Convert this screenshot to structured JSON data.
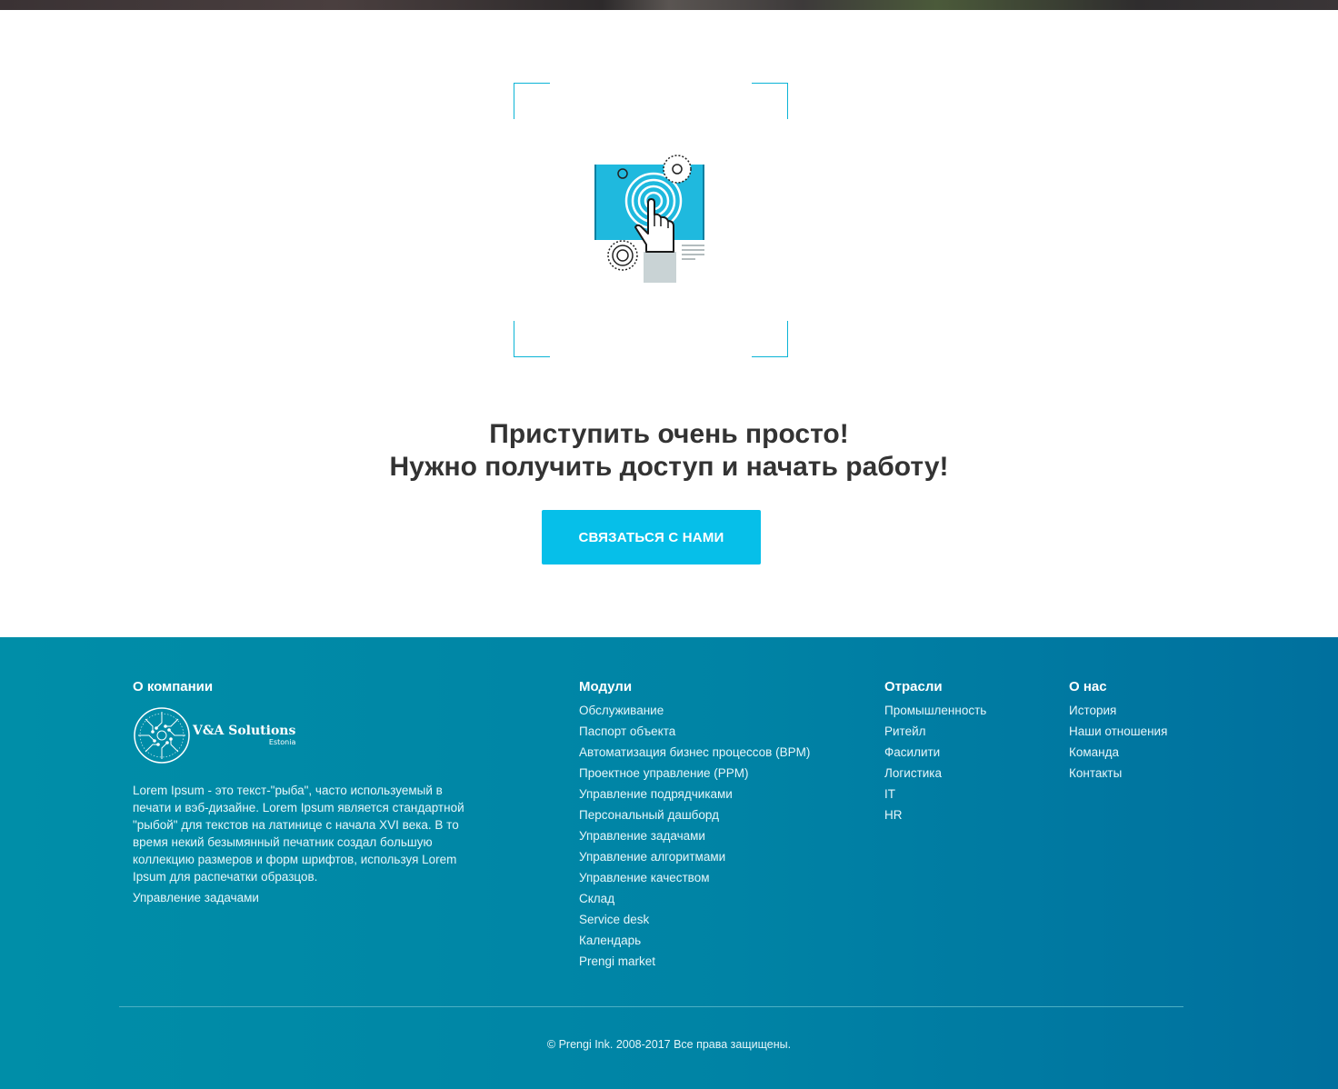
{
  "headline": {
    "line1": "Приступить очень просто!",
    "line2": "Нужно получить доступ и начать работу!"
  },
  "cta": {
    "label": "СВЯЗАТЬСЯ С НАМИ"
  },
  "colors": {
    "accent": "#06bfe9",
    "footer_bg": "#0083a5",
    "headline": "#333333"
  },
  "footer": {
    "company": {
      "title": "О компании",
      "logo_name": "V&A Solutions",
      "logo_sub": "Estonia",
      "description": "Lorem Ipsum - это текст-\"рыба\", часто используемый в печати и вэб-дизайне. Lorem Ipsum является стандартной \"рыбой\" для текстов на латинице с начала XVI века. В то время некий безымянный печатник создал большую коллекцию размеров и форм шрифтов, используя Lorem Ipsum для распечатки образцов.",
      "link": "Управление задачами"
    },
    "modules": {
      "title": "Модули",
      "items": [
        "Обслуживание",
        "Паспорт объекта",
        "Автоматизация бизнес процессов (BPM)",
        "Проектное управление (PPM)",
        "Управление подрядчиками",
        "Персональный дашборд",
        "Управление задачами",
        "Управление алгоритмами",
        "Управление качеством",
        "Склад",
        "Service desk",
        "Календарь",
        "Prengi market"
      ]
    },
    "industries": {
      "title": "Отрасли",
      "items": [
        "Промышленность",
        "Ритейл",
        "Фасилити",
        "Логистика",
        "IT",
        "HR"
      ]
    },
    "about": {
      "title": "О нас",
      "items": [
        "История",
        "Наши отношения",
        "Команда",
        "Контакты"
      ]
    },
    "copyright": "© Prengi Ink. 2008-2017 Все права защищены."
  },
  "icons": {
    "illustration": "touch-screen-illustration-icon",
    "logo": "circuit-logo-icon"
  }
}
